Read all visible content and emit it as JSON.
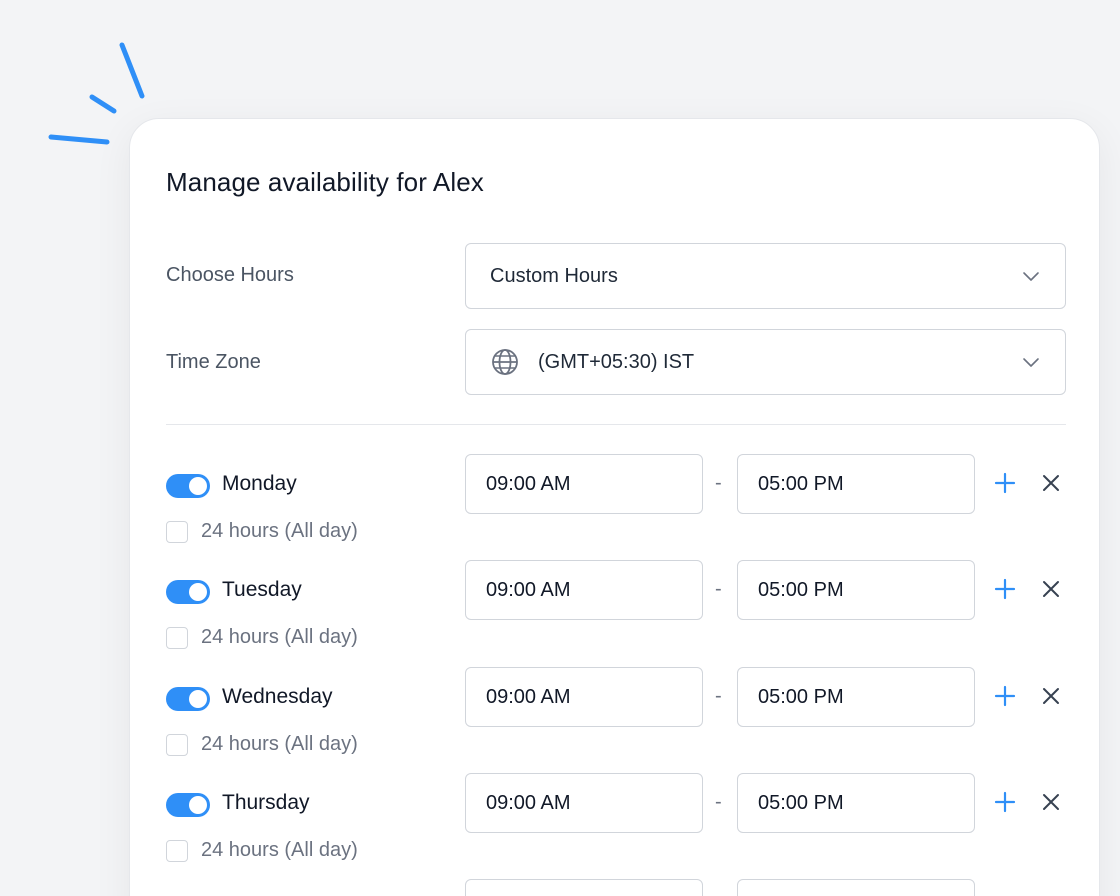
{
  "title": "Manage availability for Alex",
  "choose_hours": {
    "label": "Choose Hours",
    "value": "Custom Hours"
  },
  "time_zone": {
    "label": "Time Zone",
    "value": "(GMT+05:30) IST"
  },
  "days": [
    {
      "name": "Monday",
      "enabled": true,
      "all_day_label": "24 hours (All day)",
      "start": "09:00 AM",
      "separator": "-",
      "end": "05:00 PM"
    },
    {
      "name": "Tuesday",
      "enabled": true,
      "all_day_label": "24 hours (All day)",
      "start": "09:00 AM",
      "separator": "-",
      "end": "05:00 PM"
    },
    {
      "name": "Wednesday",
      "enabled": true,
      "all_day_label": "24 hours (All day)",
      "start": "09:00 AM",
      "separator": "-",
      "end": "05:00 PM"
    },
    {
      "name": "Thursday",
      "enabled": true,
      "all_day_label": "24 hours (All day)",
      "start": "09:00 AM",
      "separator": "-",
      "end": "05:00 PM"
    }
  ],
  "icons": {
    "add": "plus-icon",
    "remove": "close-icon",
    "dropdown": "chevron-down-icon",
    "timezone": "globe-icon"
  },
  "colors": {
    "accent": "#2f8ff7",
    "sparkle": "#2f8ff7"
  }
}
